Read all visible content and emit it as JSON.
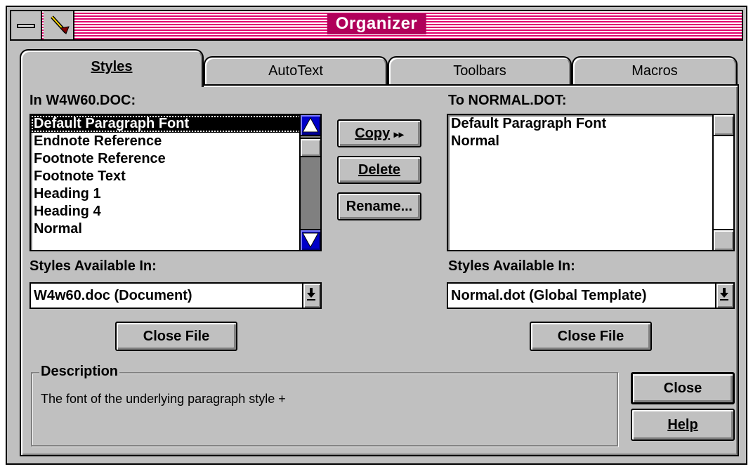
{
  "window": {
    "title": "Organizer"
  },
  "tabs": [
    {
      "label": "Styles",
      "hotkey_index": 0,
      "active": true
    },
    {
      "label": "AutoText",
      "hotkey_index": 0,
      "active": false
    },
    {
      "label": "Toolbars",
      "hotkey_index": 0,
      "active": false
    },
    {
      "label": "Macros",
      "hotkey_index": 0,
      "active": false
    }
  ],
  "left": {
    "list_label": "In W4W60.DOC:",
    "items": [
      "Default Paragraph Font",
      "Endnote Reference",
      "Footnote Reference",
      "Footnote Text",
      "Heading 1",
      "Heading 4",
      "Normal"
    ],
    "selected_item": "Default Paragraph Font",
    "available_label": "Styles Available In:",
    "available_value": "W4w60.doc (Document)",
    "close_file_label": "Close File"
  },
  "right": {
    "list_label": "To NORMAL.DOT:",
    "items": [
      "Default Paragraph Font",
      "Normal"
    ],
    "available_label": "Styles Available In:",
    "available_value": "Normal.dot (Global Template)",
    "close_file_label": "Close File"
  },
  "actions": {
    "copy_label": "Copy",
    "copy_suffix": "▸▸",
    "delete_label": "Delete",
    "rename_label": "Rename..."
  },
  "description": {
    "title": "Description",
    "text": "The font of the underlying paragraph style +"
  },
  "dialog_buttons": {
    "close_label": "Close",
    "help_label": "Help"
  },
  "colors": {
    "titlebar": "#e0006e",
    "face": "#c0c0c0",
    "scroll_arrow": "#0000c8"
  }
}
